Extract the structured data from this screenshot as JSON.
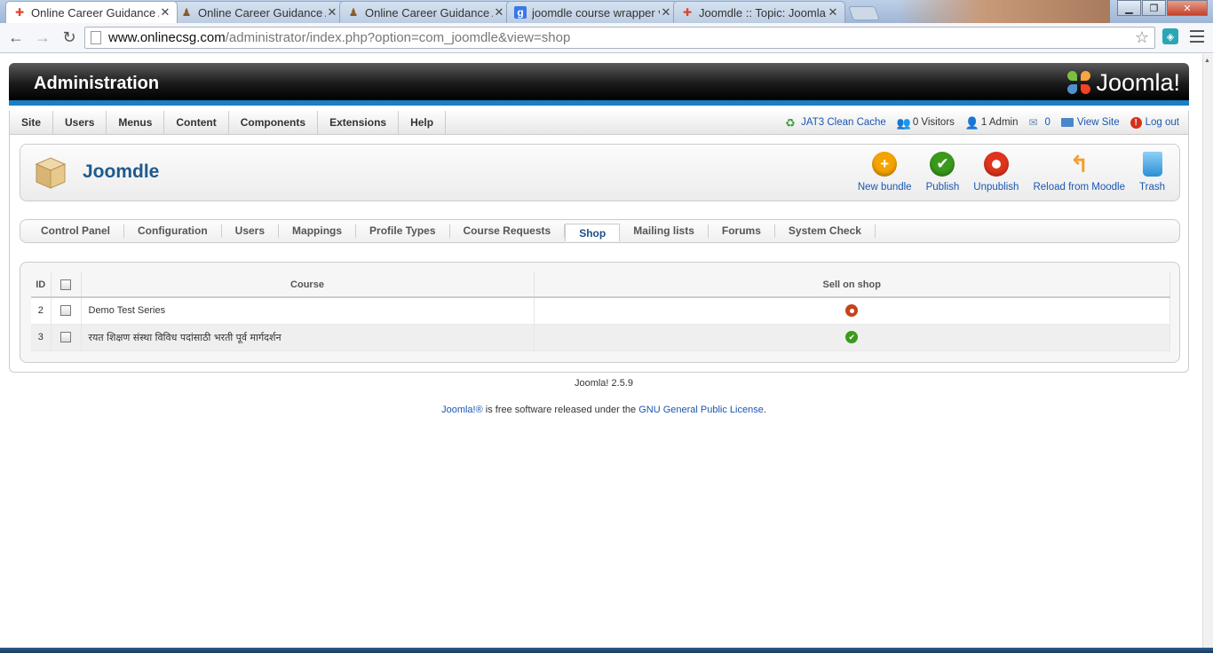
{
  "browser": {
    "tabs": [
      {
        "title": "Online Career Guidance A",
        "active": true,
        "favicon": "joomla-icon"
      },
      {
        "title": "Online Career Guidance A",
        "active": false,
        "favicon": "person-icon"
      },
      {
        "title": "Online Career Guidance A",
        "active": false,
        "favicon": "person-icon"
      },
      {
        "title": "joomdle course wrapper v",
        "active": false,
        "favicon": "google-icon"
      },
      {
        "title": "Joomdle :: Topic: Joomla c",
        "active": false,
        "favicon": "joomla-icon"
      }
    ],
    "url_host": "www.onlinecsg.com",
    "url_path": "/administrator/index.php?option=com_joomdle&view=shop"
  },
  "header": {
    "title": "Administration",
    "logo_text": "Joomla!"
  },
  "menu": {
    "items": [
      "Site",
      "Users",
      "Menus",
      "Content",
      "Components",
      "Extensions",
      "Help"
    ],
    "status": {
      "cache": "JAT3 Clean Cache",
      "visitors": "0 Visitors",
      "admin": "1 Admin",
      "messages": "0",
      "view_site": "View Site",
      "logout": "Log out"
    }
  },
  "component": {
    "title": "Joomdle",
    "actions": [
      {
        "label": "New bundle",
        "icon": "plus-icon",
        "color": "#f5a300"
      },
      {
        "label": "Publish",
        "icon": "check-icon",
        "color": "#3a9a1c"
      },
      {
        "label": "Unpublish",
        "icon": "unpublish-icon",
        "color": "#e0341e"
      },
      {
        "label": "Reload from Moodle",
        "icon": "reload-arrow-icon",
        "color": "#f0a030"
      },
      {
        "label": "Trash",
        "icon": "trash-icon",
        "color": "#3aa0e0"
      }
    ]
  },
  "submenu": {
    "items": [
      "Control Panel",
      "Configuration",
      "Users",
      "Mappings",
      "Profile Types",
      "Course Requests",
      "Shop",
      "Mailing lists",
      "Forums",
      "System Check"
    ],
    "active": "Shop"
  },
  "table": {
    "headers": {
      "id": "ID",
      "course": "Course",
      "sell": "Sell on shop"
    },
    "rows": [
      {
        "id": "2",
        "course": "Demo Test Series",
        "sell_on_shop": false
      },
      {
        "id": "3",
        "course": "रयत शिक्षण संस्था विविध पदांसाठी भरती पूर्व मार्गदर्शन",
        "sell_on_shop": true
      }
    ]
  },
  "footer": {
    "version": "Joomla! 2.5.9",
    "license_link1": "Joomla!®",
    "license_text": " is free software released under the ",
    "license_link2": "GNU General Public License",
    "license_end": "."
  }
}
